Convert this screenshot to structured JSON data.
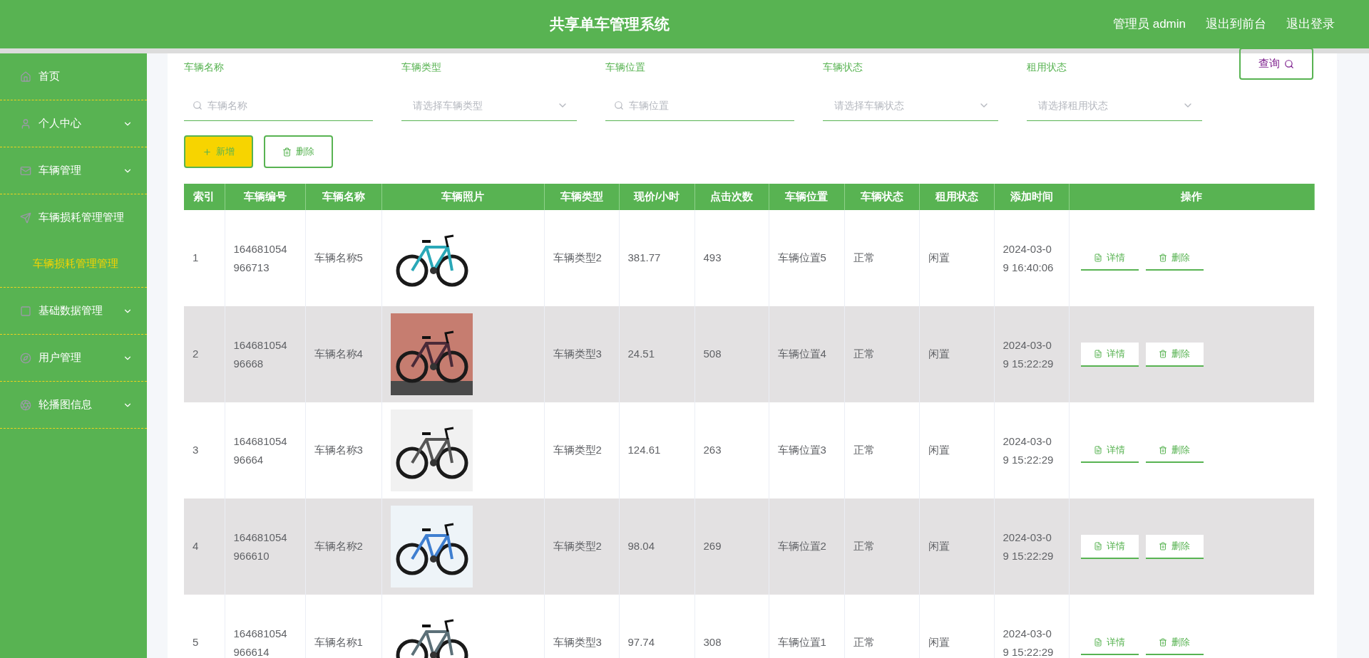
{
  "header": {
    "title": "共享单车管理系统",
    "links": [
      "管理员 admin",
      "退出到前台",
      "退出登录"
    ]
  },
  "sidebar": {
    "items": [
      {
        "label": "首页",
        "selected": false
      },
      {
        "label": "个人中心",
        "selected": false,
        "expanded": false
      },
      {
        "label": "车辆管理",
        "selected": false,
        "expanded": false
      },
      {
        "label": "车辆损耗管理管理",
        "selected": false,
        "expanded": true,
        "children": [
          {
            "label": "车辆损耗管理管理",
            "selected": true
          }
        ]
      },
      {
        "label": "基础数据管理",
        "selected": false,
        "expanded": false
      },
      {
        "label": "用户管理",
        "selected": false,
        "expanded": false
      },
      {
        "label": "轮播图信息",
        "selected": false,
        "expanded": false
      }
    ]
  },
  "filters": [
    {
      "kind": "text",
      "label": "车辆名称",
      "placeholder": "车辆名称"
    },
    {
      "kind": "select",
      "label": "车辆类型",
      "placeholder": "请选择车辆类型"
    },
    {
      "kind": "text",
      "label": "车辆位置",
      "placeholder": "车辆位置"
    },
    {
      "kind": "select",
      "label": "车辆状态",
      "placeholder": "请选择车辆状态"
    },
    {
      "kind": "select",
      "label": "租用状态",
      "placeholder": "请选择租用状态"
    }
  ],
  "query_button": "查询",
  "toolbar": [
    {
      "kind": "add",
      "label": "新增"
    },
    {
      "kind": "delete",
      "label": "删除"
    }
  ],
  "table": {
    "columns": [
      "索引",
      "车辆编号",
      "车辆名称",
      "车辆照片",
      "车辆类型",
      "现价/小时",
      "点击次数",
      "车辆位置",
      "车辆状态",
      "租用状态",
      "添加时间",
      "操作"
    ],
    "rows": [
      {
        "index": "1",
        "id": "164681054966713",
        "name": "车辆名称5",
        "photo": {
          "kind": "picture"
        },
        "type": "车辆类型2",
        "price": "381.77",
        "clicks": "493",
        "location": "车辆位置5",
        "status": "正常",
        "rent": "闲置",
        "time": "2024-03-09 16:40:06",
        "actions": [
          "详情",
          "删除"
        ]
      },
      {
        "index": "2",
        "id": "16468105496668",
        "name": "车辆名称4",
        "photo": {
          "kind": "picture"
        },
        "type": "车辆类型3",
        "price": "24.51",
        "clicks": "508",
        "location": "车辆位置4",
        "status": "正常",
        "rent": "闲置",
        "time": "2024-03-09 15:22:29",
        "actions": [
          "详情",
          "删除"
        ]
      },
      {
        "index": "3",
        "id": "16468105496664",
        "name": "车辆名称3",
        "photo": {
          "kind": "picture"
        },
        "type": "车辆类型2",
        "price": "124.61",
        "clicks": "263",
        "location": "车辆位置3",
        "status": "正常",
        "rent": "闲置",
        "time": "2024-03-09 15:22:29",
        "actions": [
          "详情",
          "删除"
        ]
      },
      {
        "index": "4",
        "id": "164681054966610",
        "name": "车辆名称2",
        "photo": {
          "kind": "picture"
        },
        "type": "车辆类型2",
        "price": "98.04",
        "clicks": "269",
        "location": "车辆位置2",
        "status": "正常",
        "rent": "闲置",
        "time": "2024-03-09 15:22:29",
        "actions": [
          "详情",
          "删除"
        ]
      },
      {
        "index": "5",
        "id": "164681054966614",
        "name": "车辆名称1",
        "photo": {
          "kind": "picture"
        },
        "type": "车辆类型3",
        "price": "97.74",
        "clicks": "308",
        "location": "车辆位置1",
        "status": "正常",
        "rent": "闲置",
        "time": "2024-03-09 15:22:29",
        "actions": [
          "详情",
          "删除"
        ]
      }
    ]
  }
}
